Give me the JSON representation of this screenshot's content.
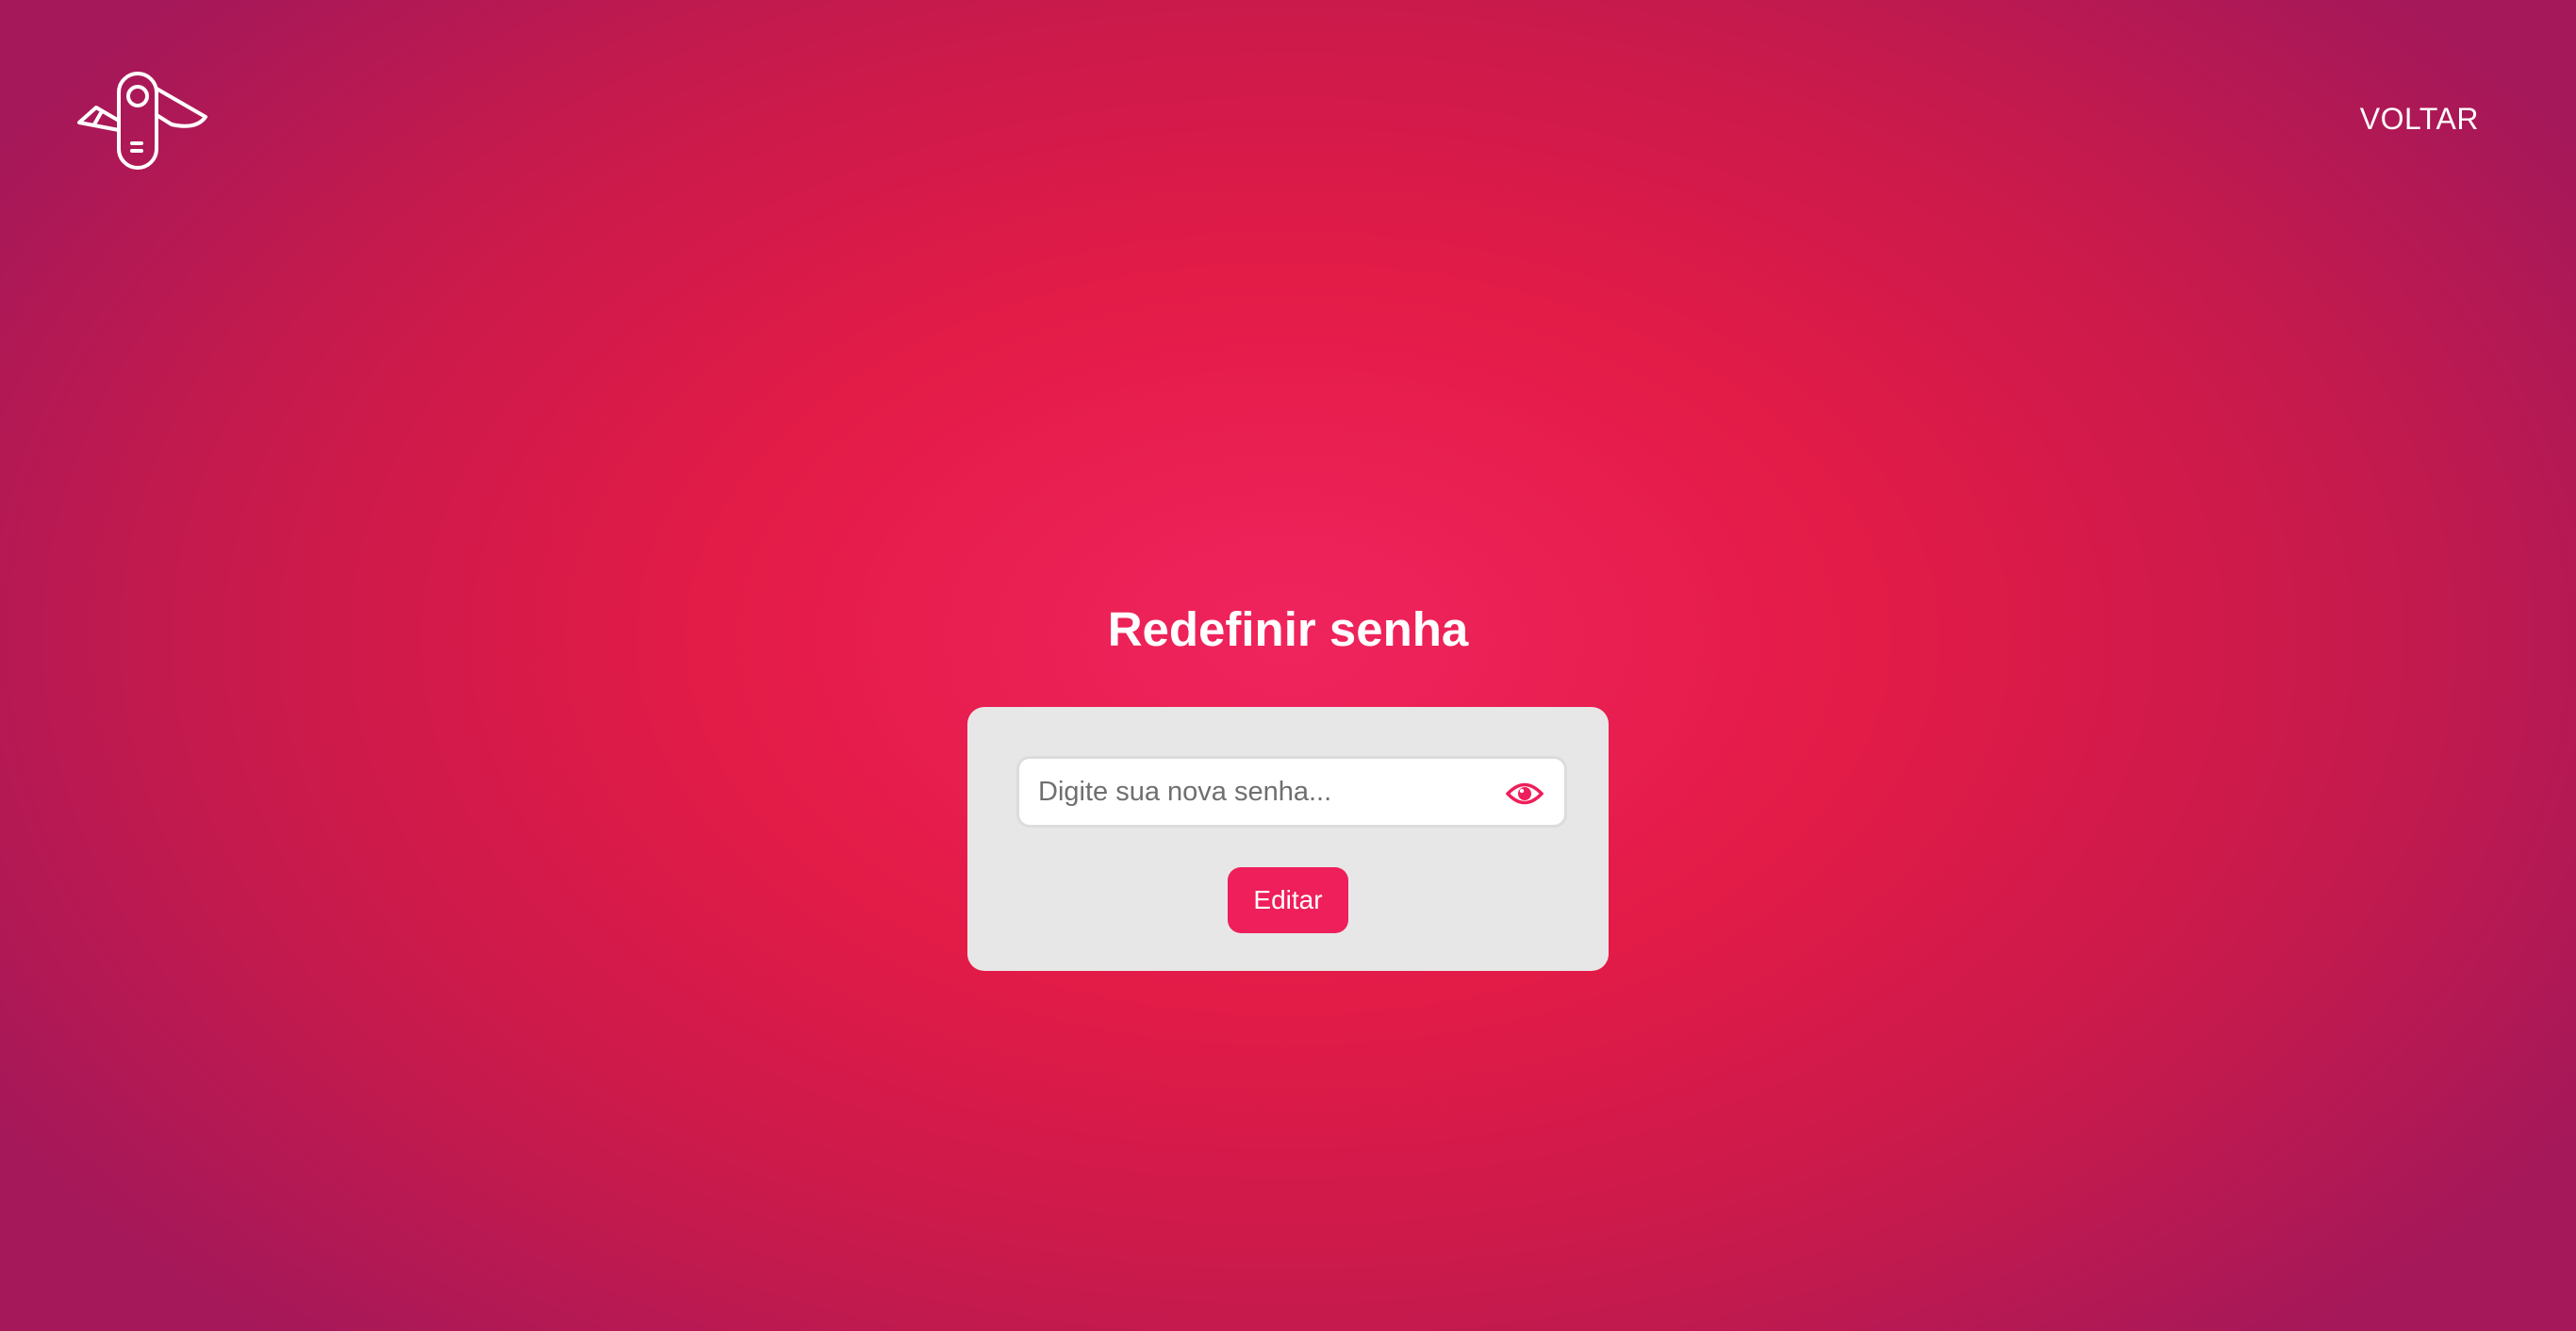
{
  "header": {
    "logo_icon": "swiss-army-knife-icon",
    "back_label": "VOLTAR"
  },
  "main": {
    "title": "Redefinir senha",
    "password_field": {
      "value": "",
      "placeholder": "Digite sua nova senha...",
      "toggle_icon": "eye-icon"
    },
    "submit_label": "Editar"
  },
  "colors": {
    "accent": "#ee1f5b",
    "card_background": "#e8e7e8",
    "background_center": "#f0245e",
    "background_edge": "#a51859"
  }
}
